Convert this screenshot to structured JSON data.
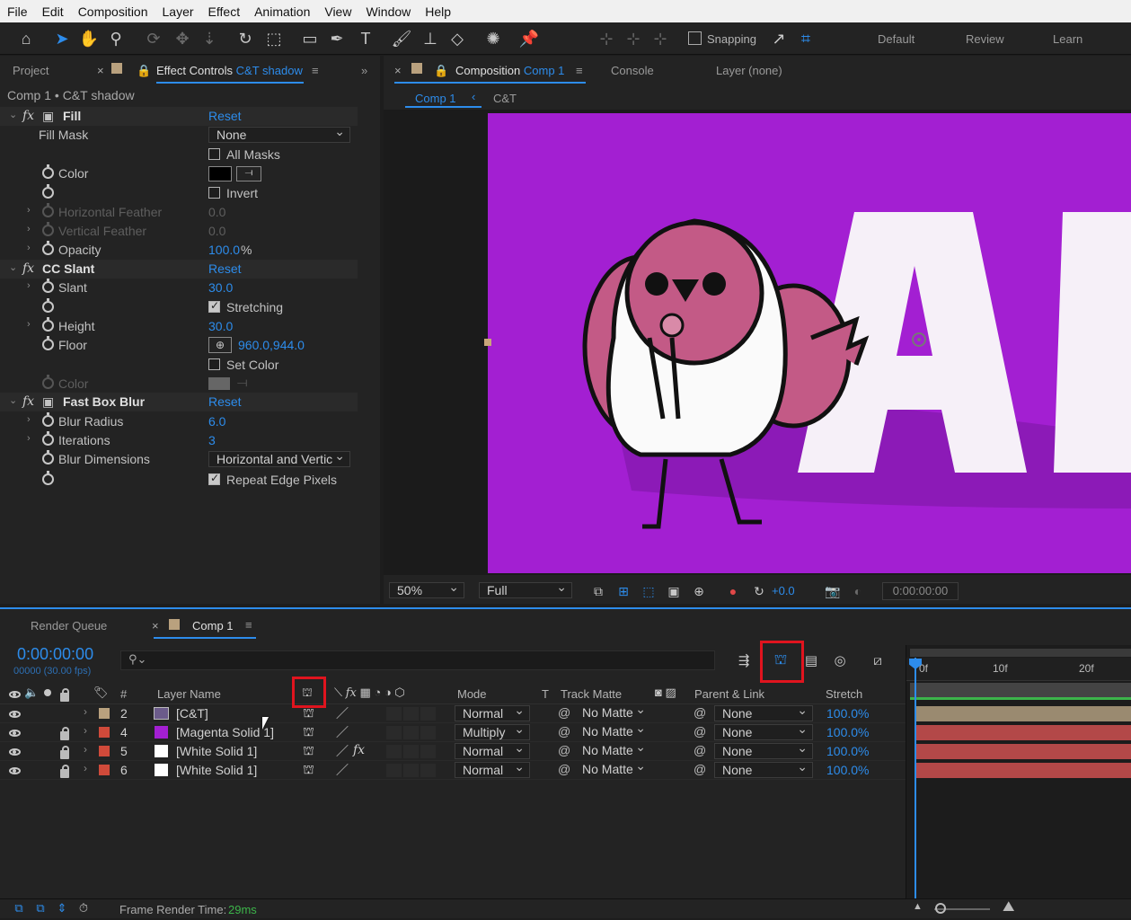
{
  "menu": [
    "File",
    "Edit",
    "Composition",
    "Layer",
    "Effect",
    "Animation",
    "View",
    "Window",
    "Help"
  ],
  "toolbar": {
    "snapping_label": "Snapping",
    "workspaces": [
      "Default",
      "Review",
      "Learn"
    ]
  },
  "left_panel": {
    "tab_project": "Project",
    "tab_effect_controls": "Effect Controls",
    "tab_effect_controls_target": "C&T shadow",
    "breadcrumb": "Comp 1 • C&T shadow",
    "effects": [
      {
        "name": "Fill",
        "reset": "Reset"
      },
      {
        "name": "CC Slant",
        "reset": "Reset"
      },
      {
        "name": "Fast Box Blur",
        "reset": "Reset"
      }
    ],
    "fill": {
      "fill_mask_label": "Fill Mask",
      "fill_mask_value": "None",
      "all_masks_label": "All Masks",
      "color_label": "Color",
      "color_value": "#000000",
      "invert_label": "Invert",
      "hfeather_label": "Horizontal Feather",
      "hfeather_value": "0.0",
      "vfeather_label": "Vertical Feather",
      "vfeather_value": "0.0",
      "opacity_label": "Opacity",
      "opacity_value": "100.0",
      "opacity_unit": "%"
    },
    "slant": {
      "slant_label": "Slant",
      "slant_value": "30.0",
      "stretching_label": "Stretching",
      "height_label": "Height",
      "height_value": "30.0",
      "floor_label": "Floor",
      "floor_value": "960.0,944.0",
      "set_color_label": "Set Color",
      "color_label": "Color"
    },
    "blur": {
      "radius_label": "Blur Radius",
      "radius_value": "6.0",
      "iterations_label": "Iterations",
      "iterations_value": "3",
      "dimensions_label": "Blur Dimensions",
      "dimensions_value": "Horizontal and Vertic",
      "repeat_label": "Repeat Edge Pixels"
    }
  },
  "comp_panel": {
    "tab_composition": "Composition",
    "tab_composition_target": "Comp 1",
    "tab_console": "Console",
    "tab_layer": "Layer (none)",
    "sub_tab_comp": "Comp 1",
    "sub_tab_ct": "C&T",
    "canvas_bg": "#a31fd2",
    "zoom": "50%",
    "resolution": "Full",
    "exposure": "+0.0",
    "timecode": "0:00:00:00"
  },
  "timeline": {
    "tab_render_queue": "Render Queue",
    "tab_comp": "Comp 1",
    "current_time": "0:00:00:00",
    "frame_info": "00000 (30.00 fps)",
    "columns": {
      "num": "#",
      "name": "Layer Name",
      "mode": "Mode",
      "t": "T",
      "track_matte": "Track Matte",
      "parent": "Parent & Link",
      "stretch": "Stretch"
    },
    "ruler": [
      "0f",
      "10f",
      "20f"
    ],
    "layers": [
      {
        "num": "2",
        "name": "[C&T]",
        "label_color": "#b9a17e",
        "swatch": "comp",
        "mode": "Normal",
        "matte": "No Matte",
        "parent": "None",
        "stretch": "100.0%",
        "locked": false,
        "fx": false
      },
      {
        "num": "4",
        "name": "[Magenta Solid 1]",
        "label_color": "#d04a3a",
        "swatch": "#a31fd2",
        "mode": "Multiply",
        "matte": "No Matte",
        "parent": "None",
        "stretch": "100.0%",
        "locked": true,
        "fx": false
      },
      {
        "num": "5",
        "name": "[White Solid 1]",
        "label_color": "#d04a3a",
        "swatch": "#ffffff",
        "mode": "Normal",
        "matte": "No Matte",
        "parent": "None",
        "stretch": "100.0%",
        "locked": true,
        "fx": true
      },
      {
        "num": "6",
        "name": "[White Solid 1]",
        "label_color": "#d04a3a",
        "swatch": "#ffffff",
        "mode": "Normal",
        "matte": "No Matte",
        "parent": "None",
        "stretch": "100.0%",
        "locked": true,
        "fx": false
      }
    ],
    "status_label": "Frame Render Time:",
    "status_value": "29ms"
  },
  "colors": {
    "accent": "#2d8ceb",
    "highlight": "#e0141e",
    "purple": "#a31fd2"
  }
}
